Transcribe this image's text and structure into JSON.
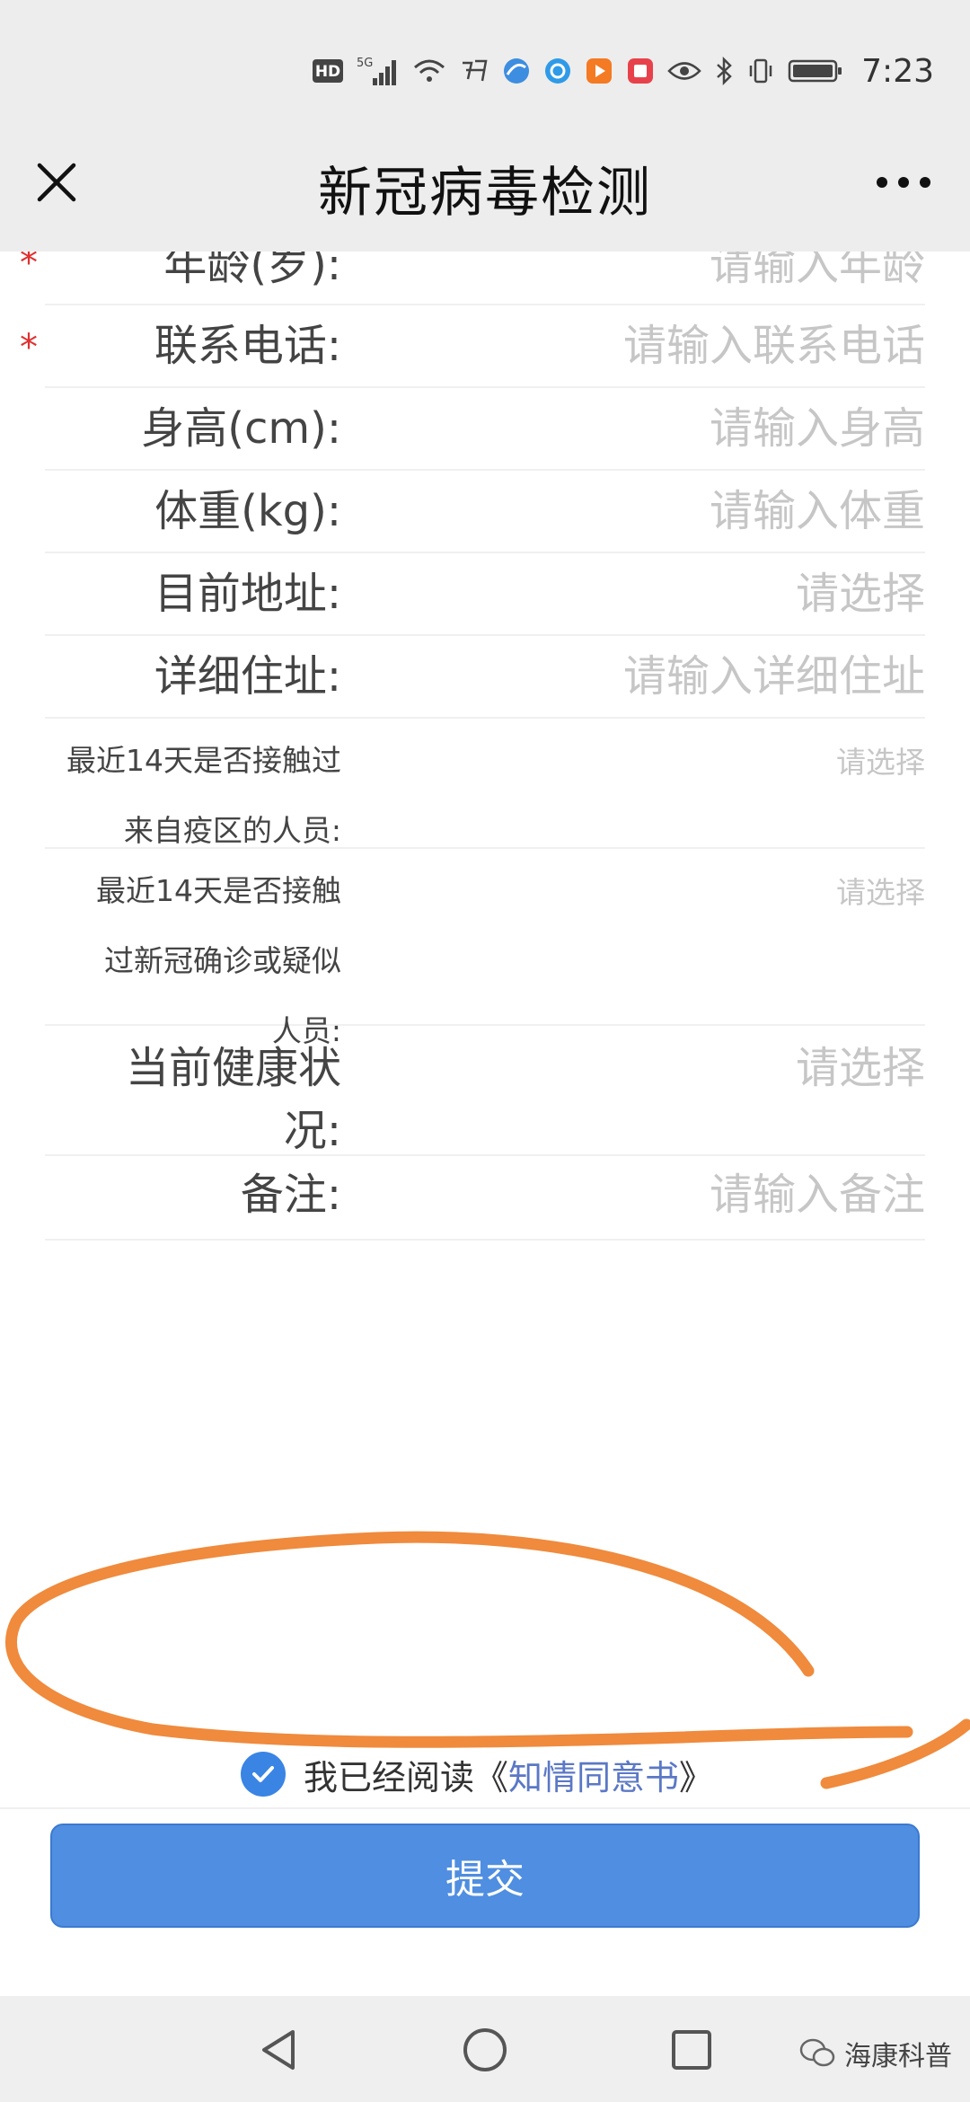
{
  "status_bar": {
    "network_badge": "HD",
    "signal_label": "5G",
    "time": "7:23"
  },
  "nav": {
    "title": "新冠病毒检测"
  },
  "form": {
    "rows": [
      {
        "label": "年龄(岁):",
        "placeholder": "请输入年龄",
        "required": true
      },
      {
        "label": "联系电话:",
        "placeholder": "请输入联系电话",
        "required": true
      },
      {
        "label": "身高(cm):",
        "placeholder": "请输入身高",
        "required": false
      },
      {
        "label": "体重(kg):",
        "placeholder": "请输入体重",
        "required": false
      },
      {
        "label": "目前地址:",
        "placeholder": "请选择",
        "required": false
      },
      {
        "label": "详细住址:",
        "placeholder": "请输入详细住址",
        "required": false
      },
      {
        "label_lines": [
          "最近14天是否接触过",
          "来自疫区的人员:"
        ],
        "placeholder": "请选择",
        "required": false
      },
      {
        "label_lines": [
          "最近14天是否接触",
          "过新冠确诊或疑似",
          "人员:"
        ],
        "placeholder": "请选择",
        "required": false
      },
      {
        "label_lines": [
          "当前健康状",
          "况:"
        ],
        "placeholder": "请选择",
        "required": false
      },
      {
        "label": "备注:",
        "placeholder": "请输入备注",
        "required": false
      }
    ],
    "required_mark": "*"
  },
  "agreement": {
    "checked": true,
    "text": "我已经阅读",
    "open_bracket": "《",
    "link": "知情同意书",
    "close_bracket": "》"
  },
  "submit_label": "提交",
  "watermark": {
    "text": "海康科普"
  },
  "colors": {
    "accent": "#4f8ee0",
    "required": "#e03030",
    "annotation": "#f08a3c",
    "link": "#5b78c6"
  }
}
